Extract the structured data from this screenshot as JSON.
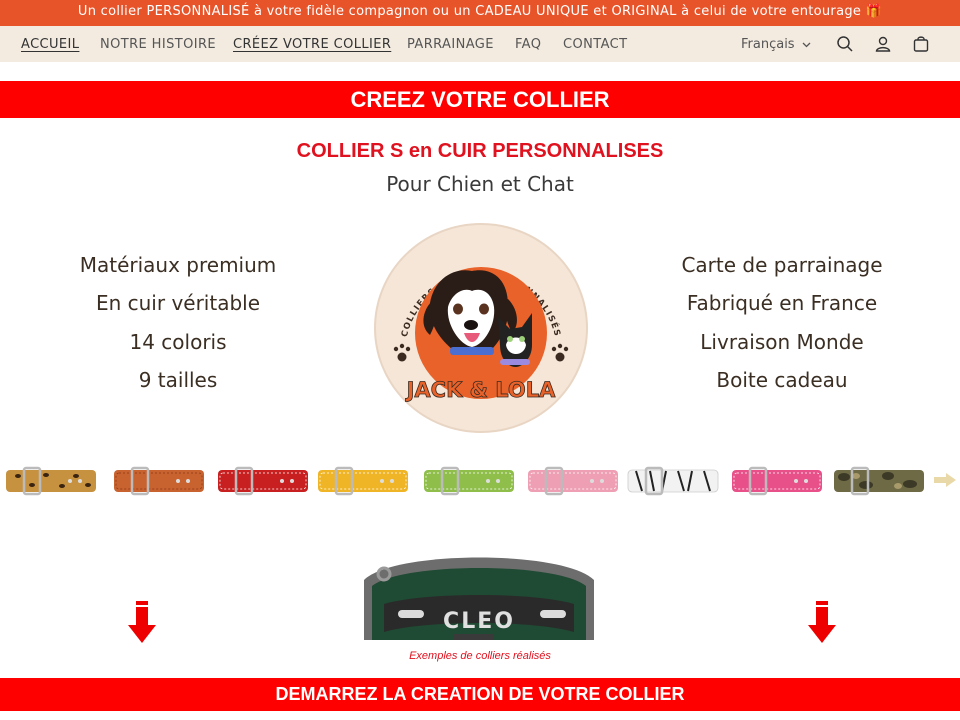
{
  "announcement": "Un collier PERSONNALISÉ à votre fidèle compagnon ou un CADEAU UNIQUE et ORIGINAL à celui de votre entourage 🎁",
  "nav": {
    "items": [
      {
        "label": "ACCUEIL",
        "active": true
      },
      {
        "label": "NOTRE HISTOIRE",
        "active": false
      },
      {
        "label": "CRÉEZ VOTRE COLLIER",
        "active": true
      },
      {
        "label": "PARRAINAGE",
        "active": false
      },
      {
        "label": "FAQ",
        "active": false
      },
      {
        "label": "CONTACT",
        "active": false
      }
    ],
    "language": "Français"
  },
  "icons": {
    "search": "search-icon",
    "account": "account-icon",
    "cart": "cart-icon",
    "language_chevron": "chevron-down-icon"
  },
  "hero": {
    "banner_title": "CREEZ VOTRE COLLIER",
    "subtitle_main": "COLLIER S en CUIR PERSONNALISES",
    "subtitle_secondary": "Pour Chien et Chat"
  },
  "features_left": [
    "Matériaux premium",
    "En cuir véritable",
    "14 coloris",
    "9 tailles"
  ],
  "features_right": [
    "Carte de parrainage",
    "Fabriqué en France",
    "Livraison Monde",
    "Boite cadeau"
  ],
  "logo": {
    "arc_text": "COLLIERS EN CUIR PERSONNALISÉS",
    "brand": "JACK & LOLA"
  },
  "collars": [
    {
      "name": "leopard",
      "color": "#c7923f",
      "accent": "#3a2410"
    },
    {
      "name": "cognac",
      "color": "#c8622f",
      "accent": "#8a3a17"
    },
    {
      "name": "red",
      "color": "#c82020",
      "accent": "#ffffff"
    },
    {
      "name": "yellow",
      "color": "#f0b526",
      "accent": "#ffffff"
    },
    {
      "name": "green",
      "color": "#8fbf4a",
      "accent": "#ffffff"
    },
    {
      "name": "pink",
      "color": "#ef9fb4",
      "accent": "#ffffff"
    },
    {
      "name": "zebra",
      "color": "#f2f2f2",
      "accent": "#222222"
    },
    {
      "name": "fuchsia",
      "color": "#e8508a",
      "accent": "#ffffff"
    },
    {
      "name": "camo",
      "color": "#6d6a45",
      "accent": "#3c3a26"
    }
  ],
  "product_example": {
    "engraving": "CLEO"
  },
  "caption": "Exemples de colliers réalisés",
  "cta_banner": "DEMARREZ LA CREATION DE VOTRE COLLIER",
  "colors": {
    "announcement_bg": "#e8542a",
    "nav_bg": "#f3ebe0",
    "banner_red": "#ff0000",
    "subtitle_red": "#e0121f",
    "logo_orange": "#e8622a"
  }
}
